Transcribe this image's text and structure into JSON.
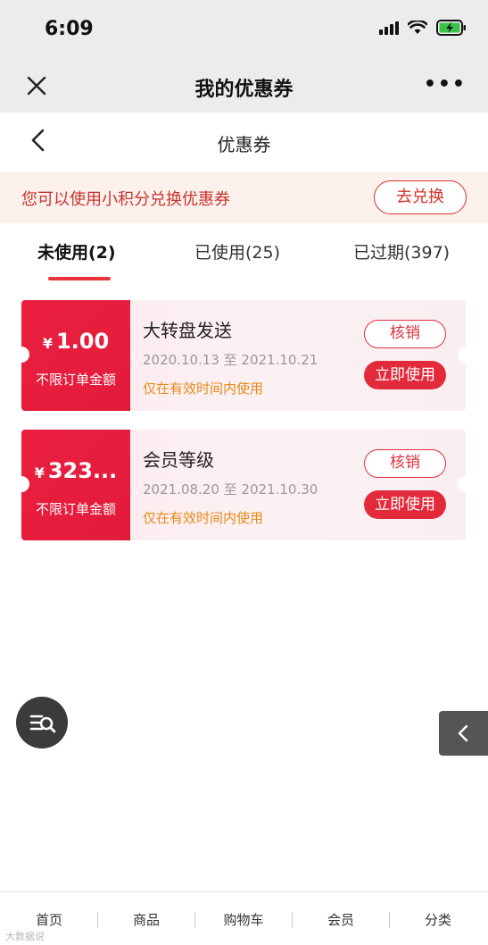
{
  "status_bar": {
    "time": "6:09"
  },
  "nav": {
    "title": "我的优惠券",
    "more": "•••"
  },
  "page": {
    "title": "优惠券"
  },
  "promo": {
    "text": "您可以使用小积分兑换优惠券",
    "button": "去兑换"
  },
  "tabs": [
    {
      "label": "未使用(2)",
      "active": true
    },
    {
      "label": "已使用(25)",
      "active": false
    },
    {
      "label": "已过期(397)",
      "active": false
    }
  ],
  "coupons": [
    {
      "currency": "¥",
      "amount": "1.00",
      "condition": "不限订单金额",
      "name": "大转盘发送",
      "date": "2020.10.13 至 2021.10.21",
      "note": "仅在有效时间内使用",
      "verify_label": "核销",
      "use_label": "立即使用"
    },
    {
      "currency": "¥",
      "amount": "323...",
      "condition": "不限订单金额",
      "name": "会员等级",
      "date": "2021.08.20 至 2021.10.30",
      "note": "仅在有效时间内使用",
      "verify_label": "核销",
      "use_label": "立即使用"
    }
  ],
  "bottom_nav": [
    {
      "label": "首页"
    },
    {
      "label": "商品"
    },
    {
      "label": "购物车"
    },
    {
      "label": "会员"
    },
    {
      "label": "分类"
    }
  ],
  "watermark": "大数据说",
  "colors": {
    "accent": "#e32a3a",
    "promo_bg": "#fdf1ed",
    "note": "#e88a1a",
    "bar_bg": "#ececec"
  },
  "icons": {
    "close": "close-icon",
    "more": "more-icon",
    "back": "chevron-left-icon",
    "float": "search-list-icon",
    "side": "chevron-left-icon",
    "signal": "signal-icon",
    "wifi": "wifi-icon",
    "battery": "battery-charging-icon"
  }
}
